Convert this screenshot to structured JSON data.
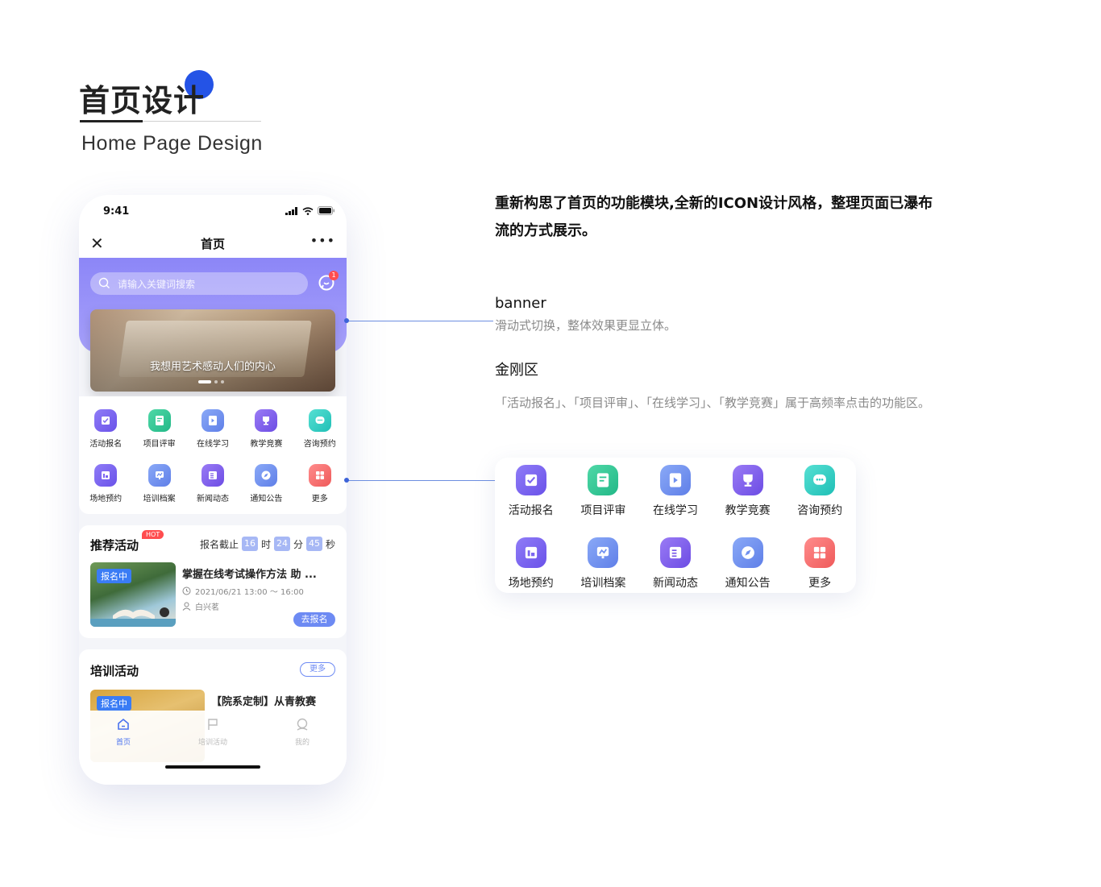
{
  "heading": {
    "title": "首页设计",
    "subtitle": "Home Page Design"
  },
  "phone": {
    "status_time": "9:41",
    "nav_title": "首页",
    "search_placeholder": "请输入关键词搜索",
    "msg_badge": "1",
    "banner_caption": "我想用艺术感动人们的内心",
    "grid_row1": [
      {
        "label": "活动报名",
        "icon": "flag-icon",
        "color": "#7c66f0"
      },
      {
        "label": "项目评审",
        "icon": "document-check-icon",
        "color": "#2fc794"
      },
      {
        "label": "在线学习",
        "icon": "play-book-icon",
        "color": "#7090ef"
      },
      {
        "label": "教学竞赛",
        "icon": "trophy-icon",
        "color": "#7b5ae8"
      },
      {
        "label": "咨询预约",
        "icon": "chat-icon",
        "color": "#2cccc1"
      }
    ],
    "grid_row2": [
      {
        "label": "场地预约",
        "icon": "venue-icon",
        "color": "#7c66f0"
      },
      {
        "label": "培训档案",
        "icon": "chart-board-icon",
        "color": "#7090ef"
      },
      {
        "label": "新闻动态",
        "icon": "news-icon",
        "color": "#7b5ae8"
      },
      {
        "label": "通知公告",
        "icon": "compass-icon",
        "color": "#7090ef"
      },
      {
        "label": "更多",
        "icon": "more-grid-icon",
        "color": "#f06a6a"
      }
    ],
    "recommend": {
      "title": "推荐活动",
      "hot": "HOT",
      "deadline_label": "报名截止",
      "hours": "16",
      "hours_unit": "时",
      "minutes": "24",
      "minutes_unit": "分",
      "seconds": "45",
      "seconds_unit": "秒",
      "item_badge": "报名中",
      "item_title": "掌握在线考试操作方法 助 ...",
      "item_time": "2021/06/21 13:00 ～ 16:00",
      "item_author": "白兴茗",
      "signup_button": "去报名"
    },
    "training": {
      "title": "培训活动",
      "more_button": "更多",
      "item_badge": "报名中",
      "item_title": "【院系定制】从青教赛"
    },
    "tabbar": [
      {
        "label": "首页",
        "icon": "home-icon",
        "active": true
      },
      {
        "label": "培训活动",
        "icon": "flag-outline-icon",
        "active": false
      },
      {
        "label": "我的",
        "icon": "user-icon",
        "active": false
      }
    ]
  },
  "annotations": {
    "description": "重新构思了首页的功能模块,全新的ICON设计风格，整理页面已瀑布流的方式展示。",
    "banner_label": "banner",
    "banner_text": "滑动式切换，整体效果更显立体。",
    "kingkong_label": "金刚区",
    "kingkong_text": "「活动报名」、「项目评审」、「在线学习」、「教学竞赛」属于高频率点击的功能区。"
  },
  "colors": {
    "accent_blue": "#2453e6",
    "purple_header": "#8c86f7",
    "badge_red": "#ff4d4f",
    "button_blue": "#6d8af3"
  }
}
